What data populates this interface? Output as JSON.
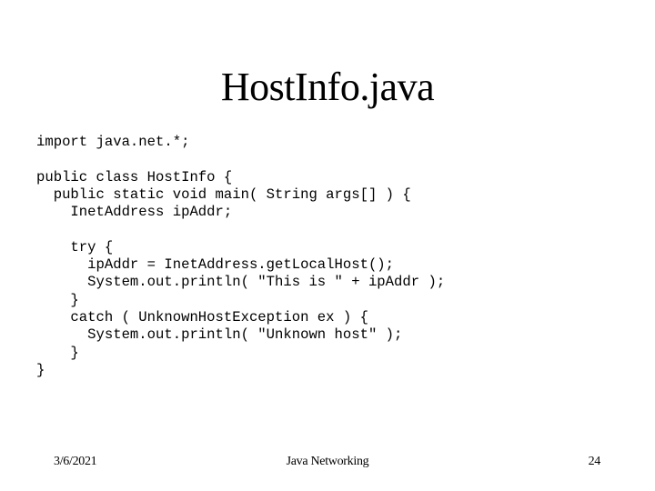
{
  "slide": {
    "title": "HostInfo.java",
    "code_lines": [
      "import java.net.*;",
      "",
      "public class HostInfo {",
      "  public static void main( String args[] ) {",
      "    InetAddress ipAddr;",
      "",
      "    try {",
      "      ipAddr = InetAddress.getLocalHost();",
      "      System.out.println( \"This is \" + ipAddr );",
      "    }",
      "    catch ( UnknownHostException ex ) {",
      "      System.out.println( \"Unknown host\" );",
      "    }",
      "}"
    ]
  },
  "footer": {
    "date": "3/6/2021",
    "center": "Java Networking",
    "page_number": "24"
  }
}
